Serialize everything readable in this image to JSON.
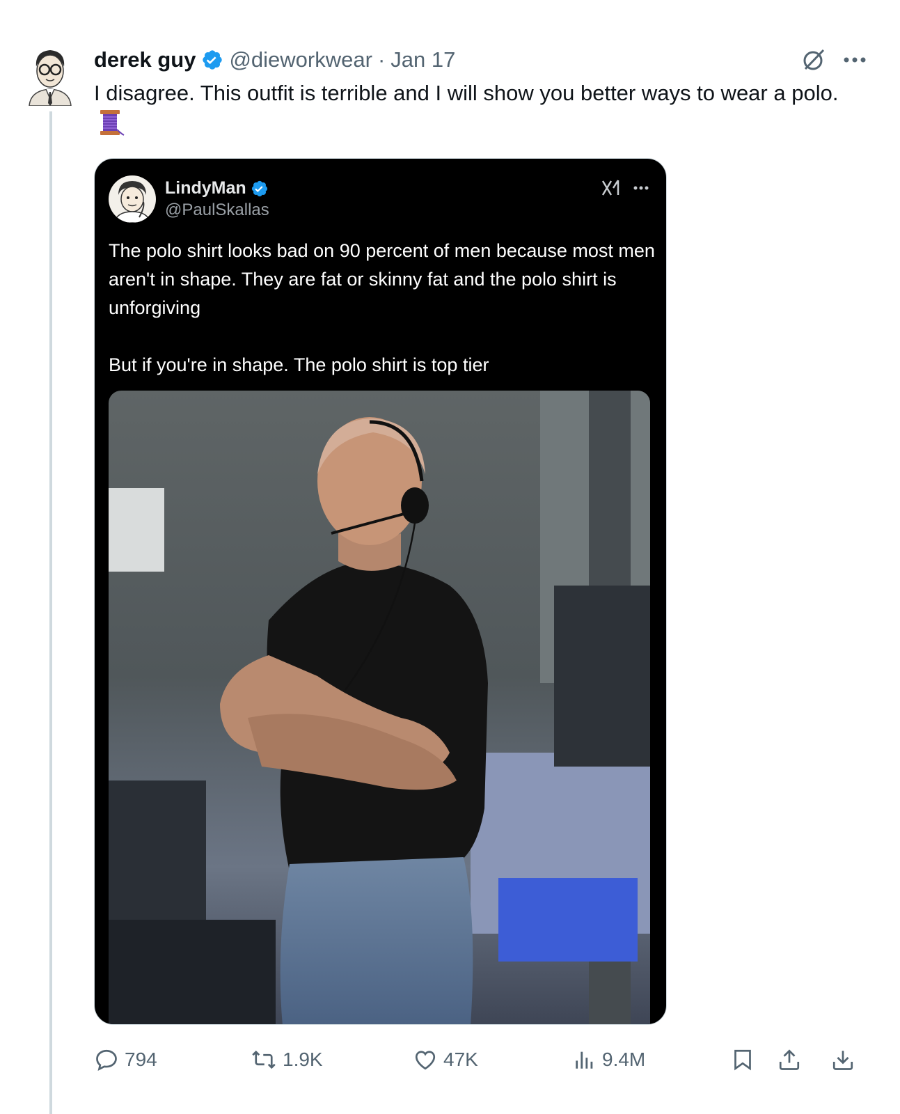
{
  "tweet": {
    "author_name": "derek guy",
    "author_handle": "@dieworkwear",
    "separator": "·",
    "date": "Jan 17",
    "text": "I disagree. This outfit is terrible and I will show you better ways to wear a polo.",
    "emoji": "spool-of-thread"
  },
  "quoted": {
    "author_name": "LindyMan",
    "author_handle": "@PaulSkallas",
    "text": "The polo shirt looks bad on 90 percent of men because most men aren't in shape. They are fat or skinny fat and the polo shirt is unforgiving\n\nBut if you're in shape. The polo shirt is top tier"
  },
  "actions": {
    "replies": "794",
    "reposts": "1.9K",
    "likes": "47K",
    "views": "9.4M"
  },
  "icons": {
    "verified": "verified-badge-icon",
    "grok": "grok-icon",
    "more": "more-icon",
    "reply": "reply-icon",
    "repost": "repost-icon",
    "like": "like-icon",
    "views": "views-icon",
    "bookmark": "bookmark-icon",
    "share": "share-icon",
    "download": "download-icon"
  },
  "colors": {
    "verified": "#1d9bf0",
    "muted": "#536471",
    "card_bg": "#000000"
  }
}
